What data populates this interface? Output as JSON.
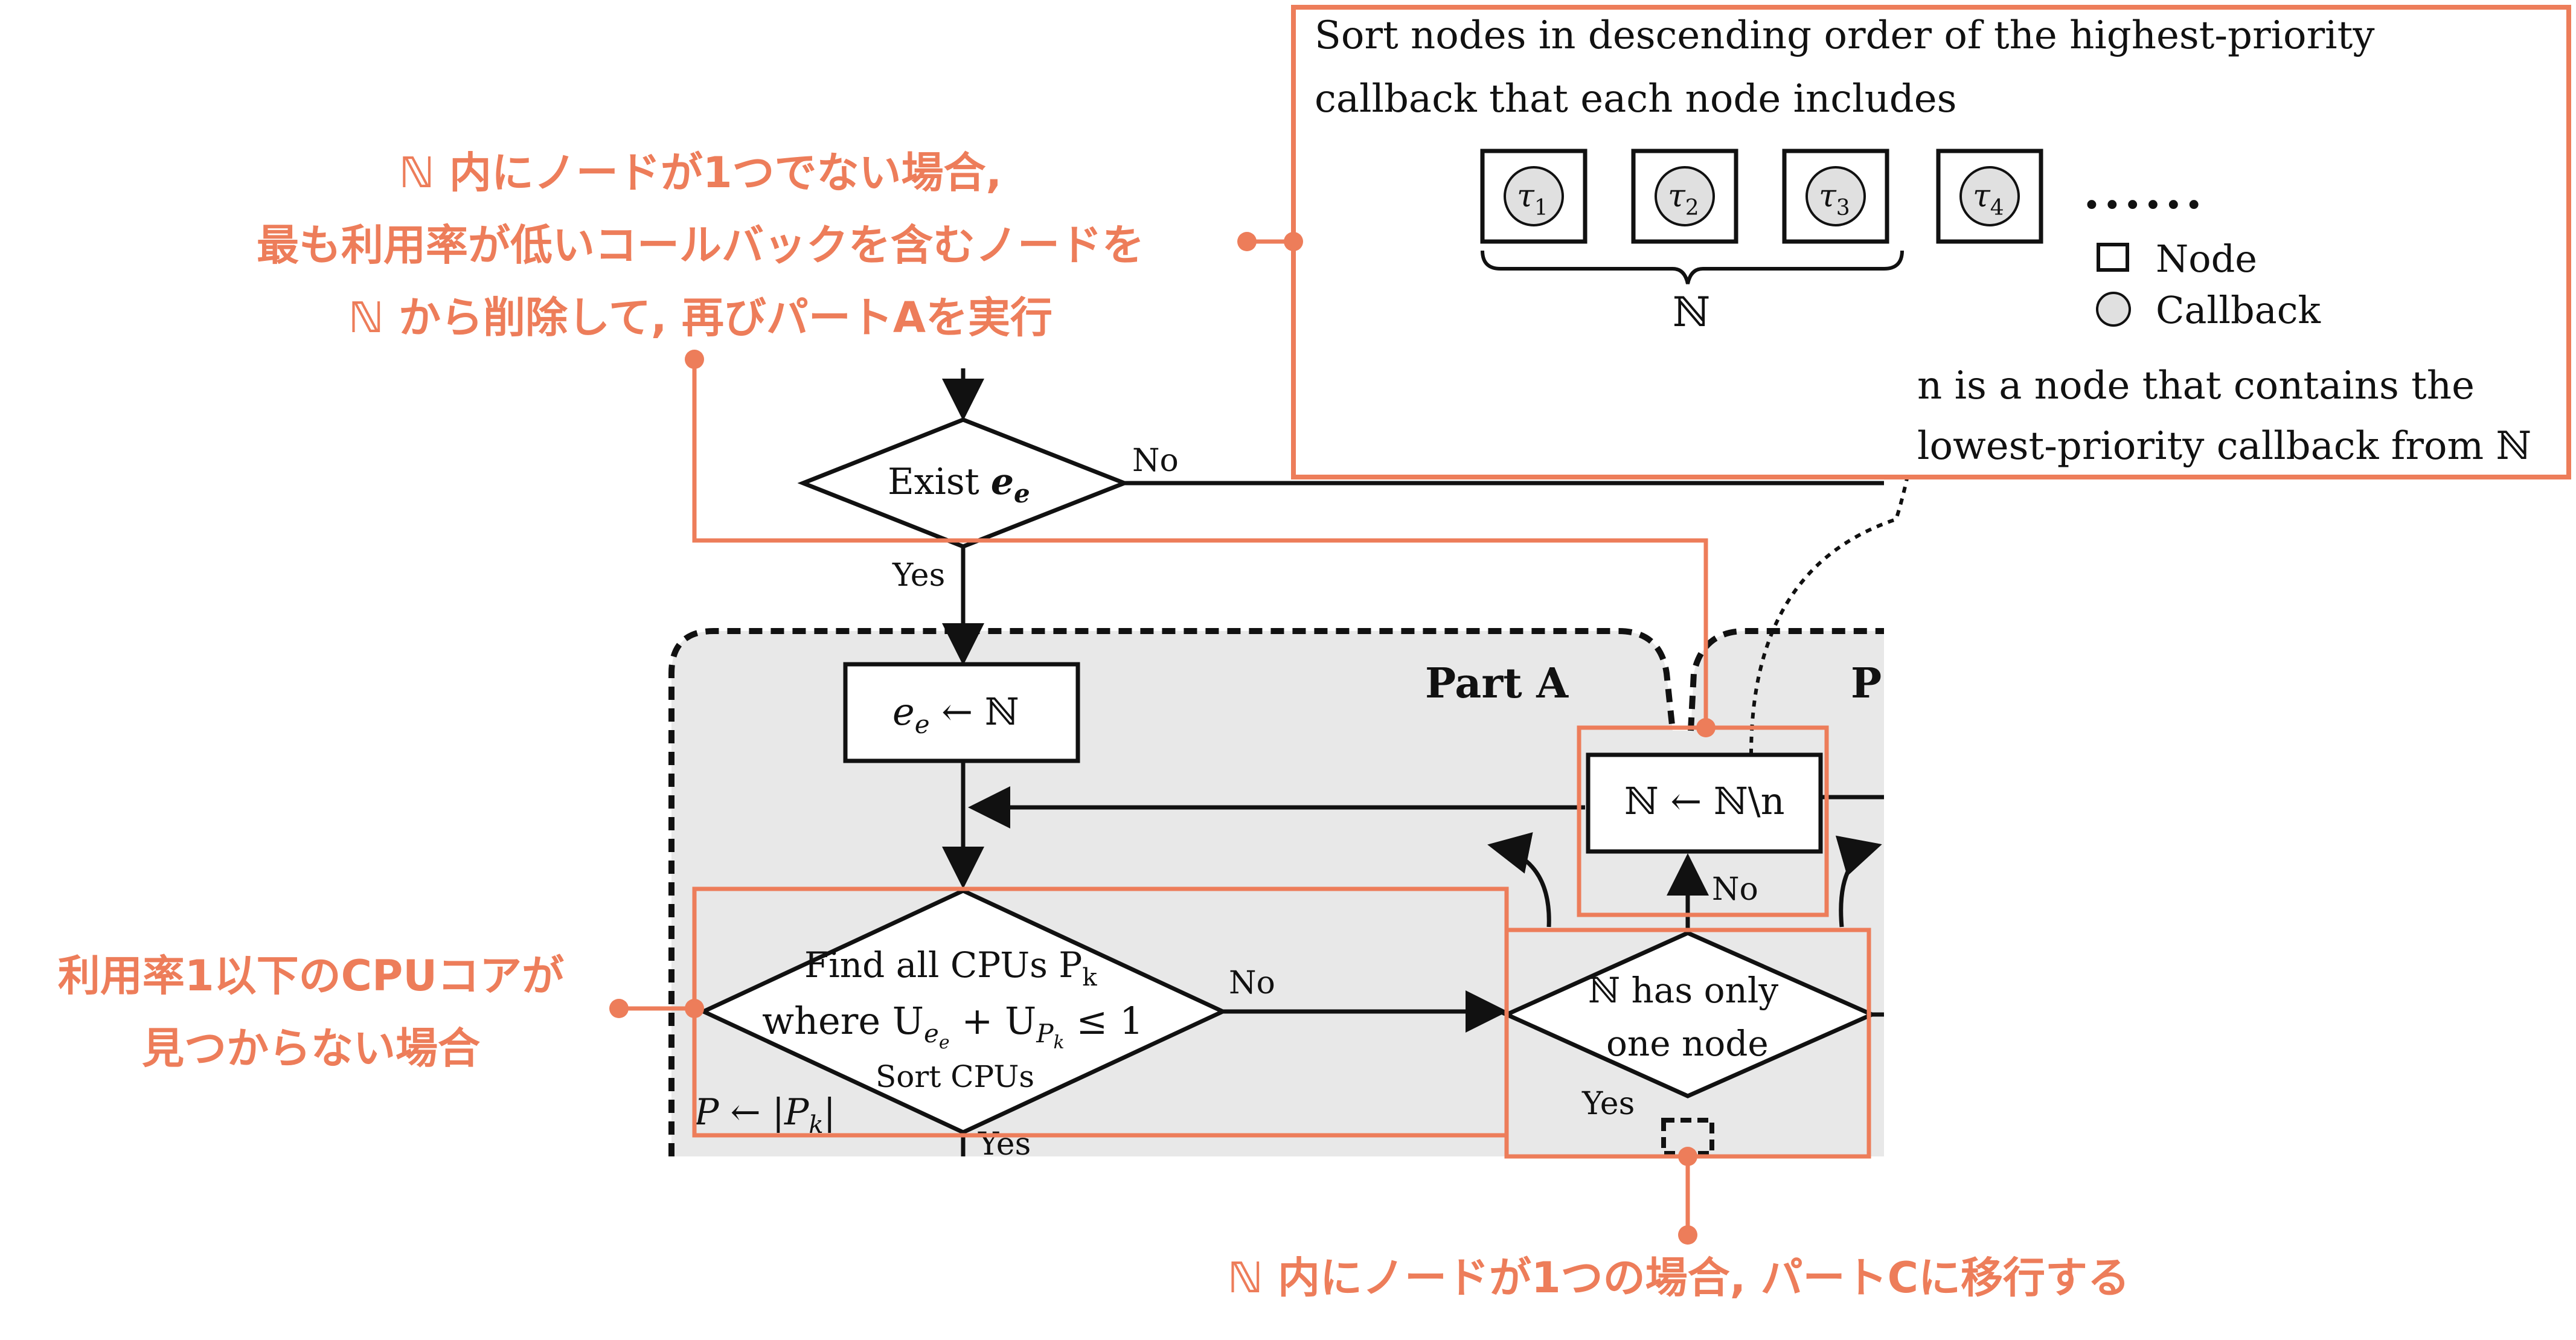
{
  "colors": {
    "accent": "#ED7D5A",
    "panel_fill": "#E8E8E8",
    "ink": "#111111"
  },
  "annotations": {
    "top_left_line1": "ℕ 内にノードが1つでない場合,",
    "top_left_line2": "最も利用率が低いコールバックを含むノードを",
    "top_left_line3": "ℕ から削除して, 再びパートAを実行",
    "left_line1": "利用率1以下のCPUコアが",
    "left_line2": "見つからない場合",
    "bottom": "ℕ 内にノードが1つの場合, パートCに移行する"
  },
  "inset": {
    "line1": "Sort nodes in descending order of the highest-priority",
    "line2": "callback that each node includes",
    "nodes": [
      {
        "symbol": "τ",
        "sub": "1"
      },
      {
        "symbol": "τ",
        "sub": "2"
      },
      {
        "symbol": "τ",
        "sub": "3"
      },
      {
        "symbol": "τ",
        "sub": "4"
      }
    ],
    "dots": "......",
    "brace_label": "ℕ",
    "legend_node": "Node",
    "legend_callback": "Callback",
    "note_line1": "n is a node that contains the",
    "note_line2": "lowest-priority callback from ℕ"
  },
  "flowchart": {
    "exist_label": "Exist ",
    "exist_var": "e",
    "exist_sub": "e",
    "exist_no": "No",
    "exist_yes": "Yes",
    "part_a": "Part A",
    "part_b_partial": "P",
    "assign_var": "e",
    "assign_sub": "e",
    "assign_rest": " ← ℕ",
    "remove_label": "ℕ ← ℕ\\n",
    "find_line1": "Find all CPUs P",
    "find_line1_sub": "k",
    "find_line2": "where U",
    "find_line2_rest": " + U",
    "find_line2_tail": " ≤ 1",
    "find_line3": "Sort CPUs",
    "find_no": "No",
    "find_yes": "Yes",
    "p_assign": "P ← |P",
    "p_assign_sub": "k",
    "p_assign_tail": "|",
    "has_one_line1": "ℕ has only",
    "has_one_line2": "one node",
    "has_one_no": "No",
    "has_one_yes": "Yes"
  }
}
